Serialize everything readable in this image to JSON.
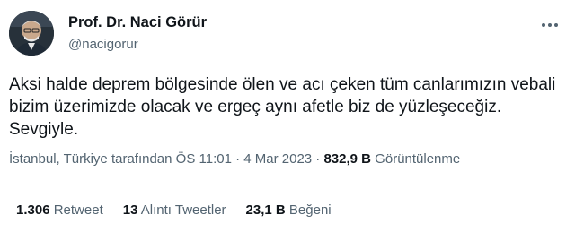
{
  "author": {
    "name": "Prof. Dr. Naci Görür",
    "handle": "@nacigorur"
  },
  "tweet": {
    "lines": [
      "Aksi halde deprem bölgesinde ölen ve acı çeken tüm canlarımızın vebali",
      "bizim üzerimizde olacak ve ergeç aynı afetle biz de yüzleşeceğiz.",
      "Sevgiyle."
    ]
  },
  "meta": {
    "source": "İstanbul, Türkiye tarafından ÖS 11:01 · 4 Mar 2023 · ",
    "views_count": "832,9 B",
    "views_label": " Görüntülenme"
  },
  "stats": {
    "retweets_count": "1.306",
    "retweets_label": " Retweet",
    "quotes_count": "13",
    "quotes_label": " Alıntı Tweetler",
    "likes_count": "23,1 B",
    "likes_label": " Beğeni"
  },
  "icons": {
    "avatar": "avatar",
    "more": "more-icon"
  }
}
